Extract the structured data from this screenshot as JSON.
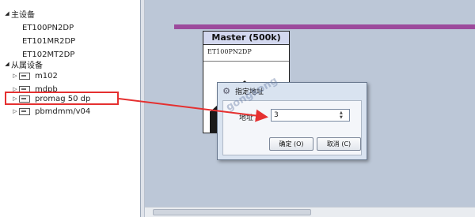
{
  "tree": {
    "master_group": "主设备",
    "masters": [
      "ET100PN2DP",
      "ET101MR2DP",
      "ET102MT2DP"
    ],
    "slave_group": "从属设备",
    "slaves": [
      "m102",
      "mdpb",
      "promag 50 dp",
      "pbmdmm/v04"
    ],
    "highlighted_slave": "promag 50 dp"
  },
  "canvas": {
    "master_title": "Master (500k)",
    "master_subtitle": "ET100PN2DP",
    "bus_color": "#9c4a9c"
  },
  "dialog": {
    "title": "指定地址",
    "label": "地址",
    "value": "3",
    "ok_label": "确定 (O)",
    "cancel_label": "取消 (C)"
  },
  "watermark": "gongkong",
  "annotation_color": "#e53030"
}
